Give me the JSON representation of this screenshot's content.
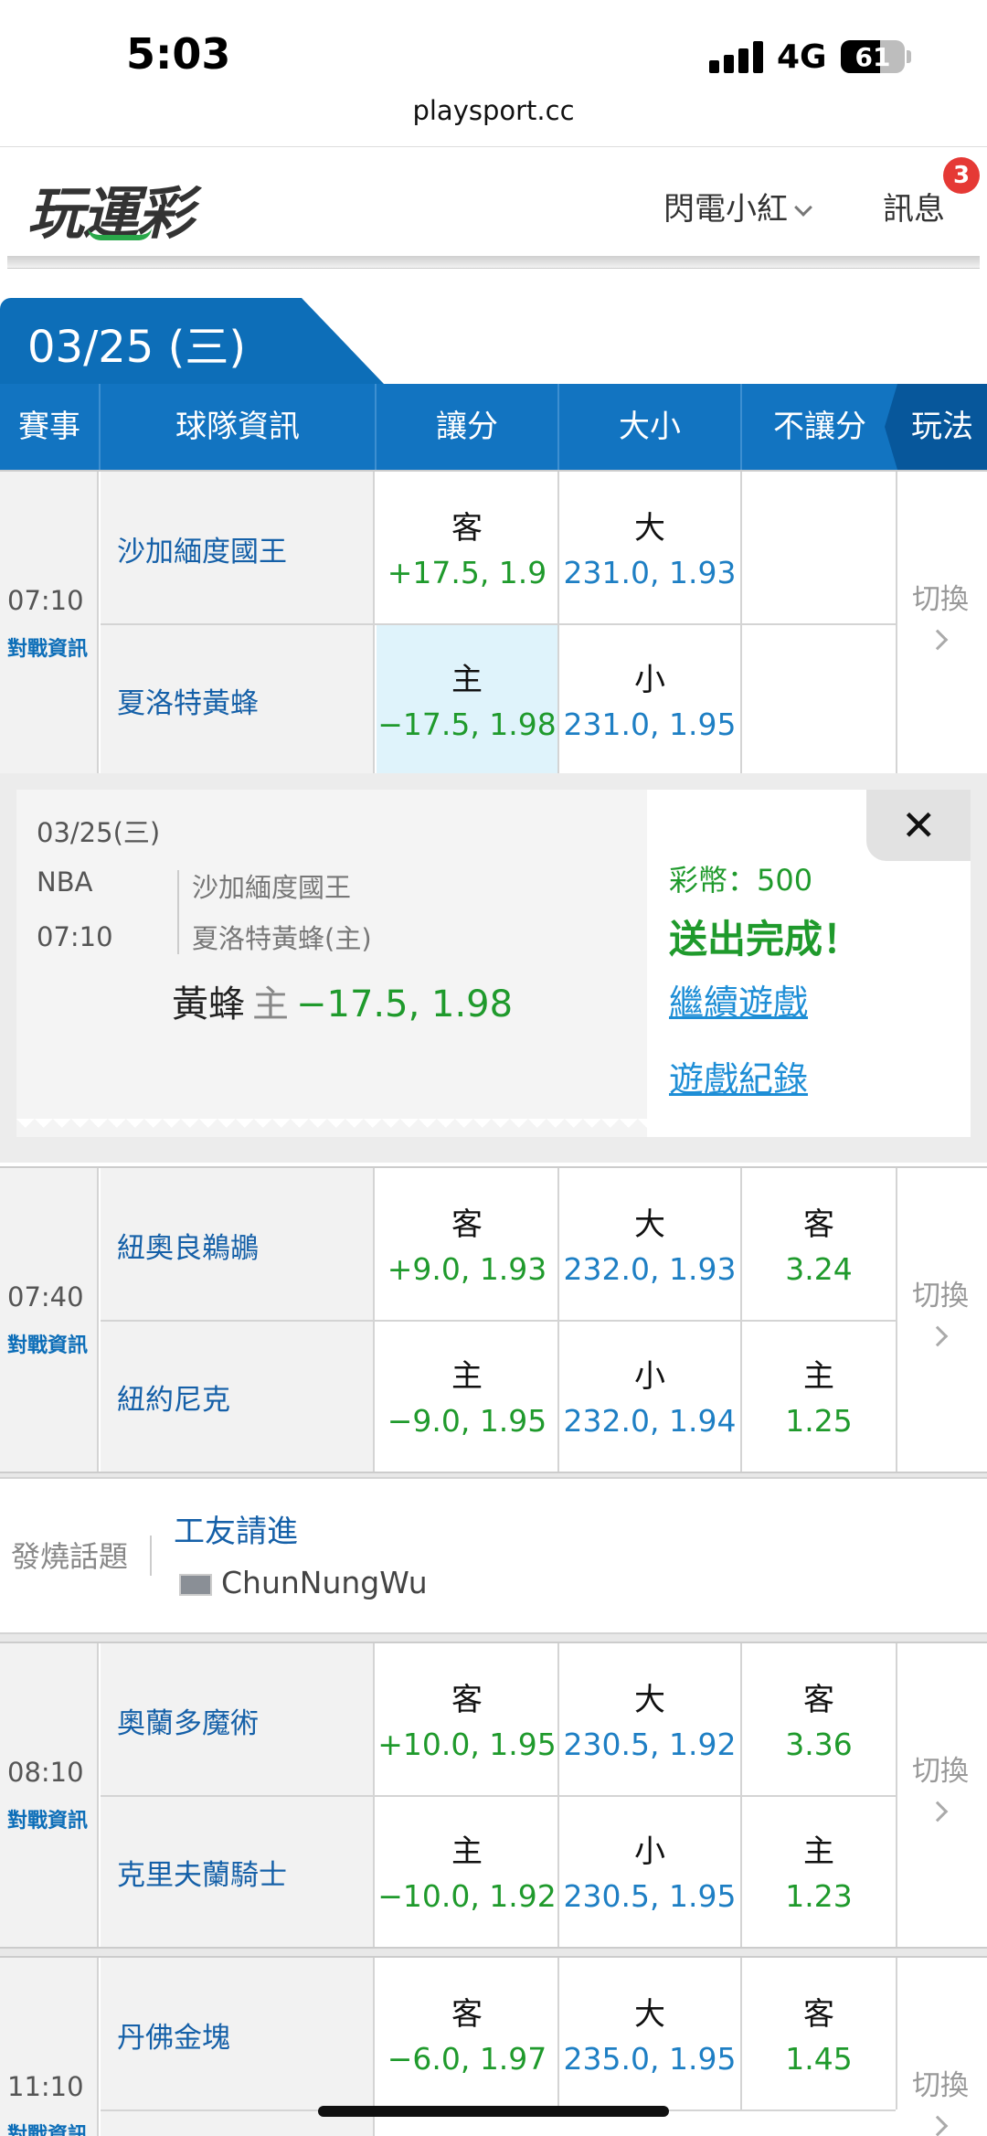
{
  "status": {
    "time": "5:03",
    "network": "4G",
    "battery": "61",
    "battery_level": 0.61
  },
  "browser": {
    "url": "playsport.cc"
  },
  "header": {
    "logo": "玩運彩",
    "user": "閃電小紅",
    "messages": "訊息",
    "badge": "3"
  },
  "date_tab": "03/25 (三)",
  "columns": {
    "event": "賽事",
    "team_info": "球隊資訊",
    "spread": "讓分",
    "total": "大小",
    "moneyline": "不讓分",
    "play": "玩法"
  },
  "labels": {
    "matchup": "對戰資訊",
    "switch": "切換"
  },
  "matches": [
    {
      "time": "07:10",
      "away": {
        "team": "沙加緬度國王",
        "spread_k": "客",
        "spread_v": "+17.5, 1.9",
        "total_k": "大",
        "total_v": "231.0, 1.93",
        "ml_k": "",
        "ml_v": ""
      },
      "home": {
        "team": "夏洛特黃蜂",
        "spread_k": "主",
        "spread_v": "−17.5, 1.98",
        "total_k": "小",
        "total_v": "231.0, 1.95",
        "ml_k": "",
        "ml_v": ""
      }
    },
    {
      "time": "07:40",
      "away": {
        "team": "紐奧良鵜鶘",
        "spread_k": "客",
        "spread_v": "+9.0, 1.93",
        "total_k": "大",
        "total_v": "232.0, 1.93",
        "ml_k": "客",
        "ml_v": "3.24"
      },
      "home": {
        "team": "紐約尼克",
        "spread_k": "主",
        "spread_v": "−9.0, 1.95",
        "total_k": "小",
        "total_v": "232.0, 1.94",
        "ml_k": "主",
        "ml_v": "1.25"
      }
    },
    {
      "time": "08:10",
      "away": {
        "team": "奧蘭多魔術",
        "spread_k": "客",
        "spread_v": "+10.0, 1.95",
        "total_k": "大",
        "total_v": "230.5, 1.92",
        "ml_k": "客",
        "ml_v": "3.36"
      },
      "home": {
        "team": "克里夫蘭騎士",
        "spread_k": "主",
        "spread_v": "−10.0, 1.92",
        "total_k": "小",
        "total_v": "230.5, 1.95",
        "ml_k": "主",
        "ml_v": "1.23"
      }
    },
    {
      "time": "11:10",
      "away": {
        "team": "丹佛金塊",
        "spread_k": "客",
        "spread_v": "−6.0, 1.97",
        "total_k": "大",
        "total_v": "235.0, 1.95",
        "ml_k": "客",
        "ml_v": "1.45"
      }
    }
  ],
  "ticket": {
    "date": "03/25(三)",
    "league": "NBA",
    "time": "07:10",
    "away": "沙加緬度國王",
    "home": "夏洛特黃蜂(主)",
    "pick_team": "黃蜂",
    "pick_side": "主",
    "pick_odds": "−17.5, 1.98",
    "coins": "彩幣：500",
    "status": "送出完成！",
    "continue": "繼續遊戲",
    "history": "遊戲紀錄",
    "close": "✕"
  },
  "hot_topic": {
    "label": "發燒話題",
    "title": "工友請進",
    "author": "ChunNungWu"
  }
}
